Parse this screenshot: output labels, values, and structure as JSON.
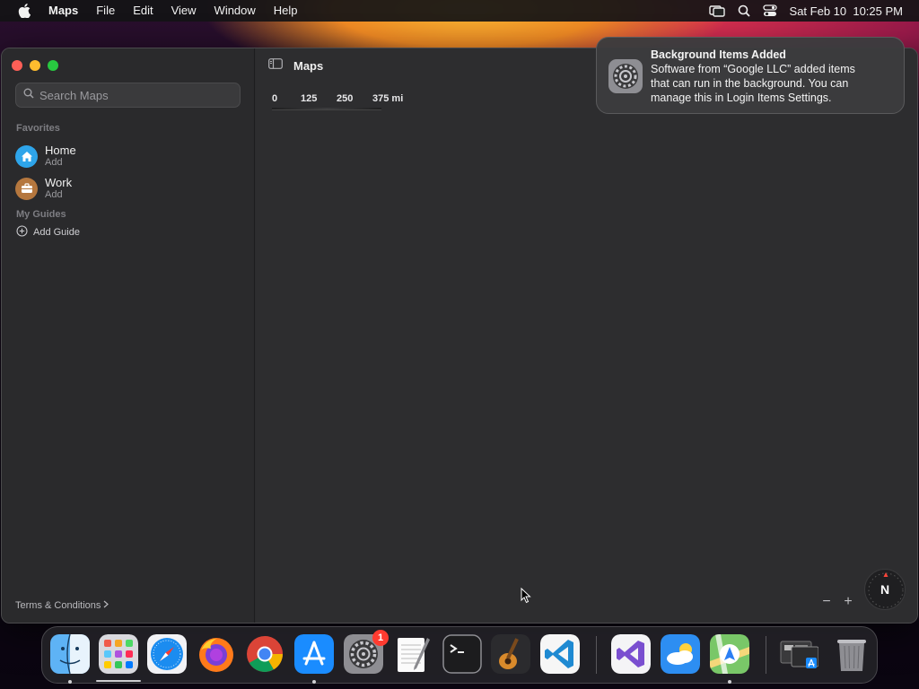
{
  "menubar": {
    "app_name": "Maps",
    "menus": [
      "File",
      "Edit",
      "View",
      "Window",
      "Help"
    ],
    "datetime": "Sat Feb 10  10:25 PM"
  },
  "window": {
    "title": "Maps"
  },
  "sidebar": {
    "search_placeholder": "Search Maps",
    "favorites_label": "Favorites",
    "favorites": [
      {
        "title": "Home",
        "subtitle": "Add",
        "icon": "house-icon",
        "color": "#2ea5ea"
      },
      {
        "title": "Work",
        "subtitle": "Add",
        "icon": "briefcase-icon",
        "color": "#b5773e"
      }
    ],
    "guides_label": "My Guides",
    "add_guide": "Add Guide",
    "terms": "Terms & Conditions"
  },
  "map": {
    "scale_labels": [
      "0",
      "125",
      "250",
      "375 mi"
    ],
    "zoom_out": "−",
    "zoom_in": "+",
    "compass": "N"
  },
  "notification": {
    "title": "Background Items Added",
    "line1": "Software from “Google LLC” added items",
    "line2": "that can run in the background. You can",
    "line3": "manage this in Login Items Settings.",
    "icon": "system-settings-gear-icon"
  },
  "dock": {
    "apps": [
      "finder-icon",
      "launchpad-icon",
      "safari-icon",
      "firefox-icon",
      "chrome-icon",
      "app-store-icon",
      "system-settings-icon",
      "textedit-icon",
      "terminal-icon",
      "garageband-icon",
      "vscode-icon",
      "visual-studio-icon",
      "weather-icon",
      "maps-icon",
      "downloads-stack-icon",
      "trash-icon"
    ],
    "settings_badge": "1"
  }
}
